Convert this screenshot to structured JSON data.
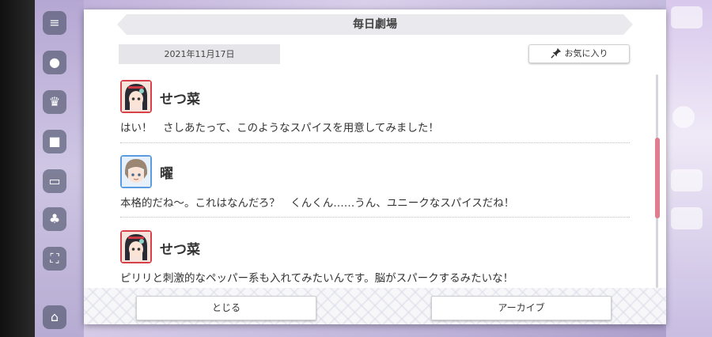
{
  "dialog": {
    "title": "毎日劇場",
    "date": "2021年11月17日",
    "favorite_label": "お気に入り",
    "entries": [
      {
        "speaker": "せつ菜",
        "avatar": "setsuna-avatar",
        "text": "はい！　さしあたって、このようなスパイスを用意してみました！"
      },
      {
        "speaker": "曜",
        "avatar": "you-avatar",
        "text": "本格的だね〜。これはなんだろ？　くんくん……うん、ユニークなスパイスだね！"
      },
      {
        "speaker": "せつ菜",
        "avatar": "setsuna-avatar",
        "text": "ピリリと刺激的なペッパー系も入れてみたいんです。脳がスパークするみたいな！"
      }
    ],
    "close_label": "とじる",
    "archive_label": "アーカイブ"
  },
  "colors": {
    "scroll_thumb": "#e07d8e",
    "title_bar": "#e9e9ee",
    "date_box": "#e5e5ea"
  },
  "icons": [
    "pin-icon",
    "menu-icon"
  ]
}
